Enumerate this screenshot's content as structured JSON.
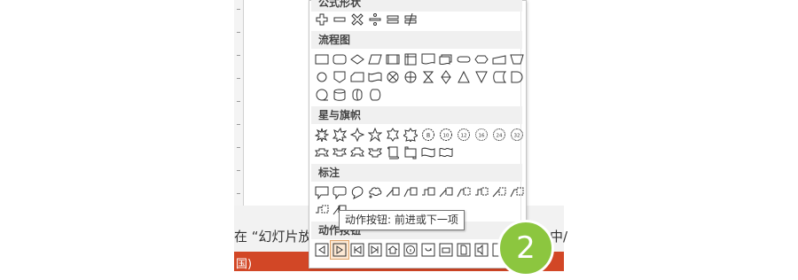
{
  "caption": {
    "text": "在 “幻灯片放映",
    "right_fragment": "中/"
  },
  "status_bar": {
    "text": "国)",
    "color": "#d24726"
  },
  "panel": {
    "categories": [
      {
        "label": "公式形状"
      },
      {
        "label": "流程图"
      },
      {
        "label": "星与旗帜"
      },
      {
        "label": "标注"
      },
      {
        "label": "动作按钮"
      }
    ]
  },
  "tooltip": {
    "text": "动作按钮: 前进或下一项"
  },
  "badge": {
    "number": "2",
    "color": "#8cc63f"
  },
  "equation_icons": [
    "plus-icon",
    "minus-icon",
    "multiply-icon",
    "divide-icon",
    "equal-icon",
    "not-equal-icon"
  ],
  "action_icons": [
    "back-previous-icon",
    "forward-next-icon",
    "beginning-icon",
    "end-icon",
    "home-icon",
    "information-icon",
    "return-icon",
    "movie-icon",
    "document-icon",
    "sound-icon",
    "help-icon",
    "custom-icon"
  ]
}
